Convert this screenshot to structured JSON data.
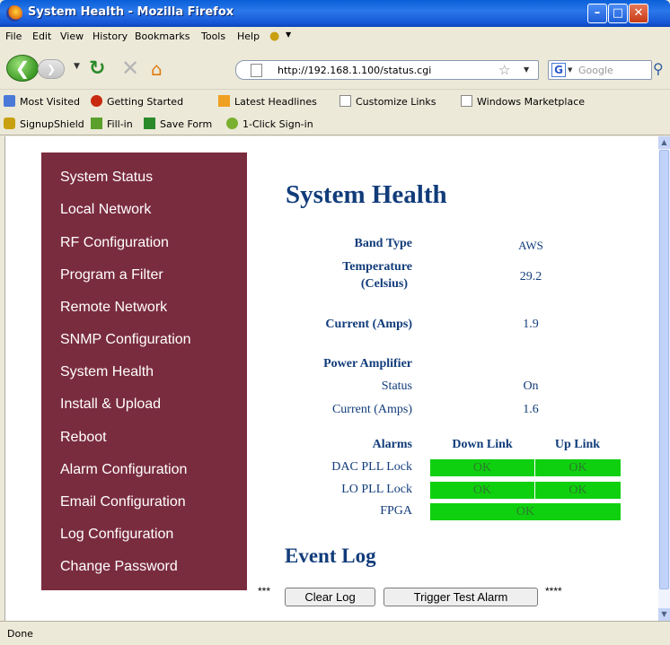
{
  "window": {
    "title": "System Health - Mozilla Firefox"
  },
  "menu": [
    "File",
    "Edit",
    "View",
    "History",
    "Bookmarks",
    "Tools",
    "Help"
  ],
  "nav": {
    "url": "http://192.168.1.100/status.cgi",
    "search_placeholder": "Google"
  },
  "bookmarks": [
    "Most Visited",
    "Getting Started",
    "Latest Headlines",
    "Customize Links",
    "Windows Marketplace"
  ],
  "signup_bar": [
    "SignupShield",
    "Fill-in",
    "Save Form",
    "1-Click Sign-in"
  ],
  "sidebar": [
    "System Status",
    "Local Network",
    "RF Configuration",
    "Program a Filter",
    "Remote Network",
    "SNMP Configuration",
    "System Health",
    "Install & Upload",
    "Reboot",
    "Alarm Configuration",
    "Email Configuration",
    "Log Configuration",
    "Change Password"
  ],
  "health": {
    "title": "System Health",
    "band_type_label": "Band Type",
    "band_type_value": "AWS",
    "temperature_label_1": "Temperature",
    "temperature_label_2": "(Celsius)",
    "temperature_value": "29.2",
    "current_label": "Current (Amps)",
    "current_value": "1.9",
    "pa_heading": "Power Amplifier",
    "pa_status_label": "Status",
    "pa_status_value": "On",
    "pa_current_label": "Current (Amps)",
    "pa_current_value": "1.6"
  },
  "alarms": {
    "heading": "Alarms",
    "down_link": "Down Link",
    "up_link": "Up Link",
    "rows": [
      {
        "name": "DAC PLL Lock",
        "down": "OK",
        "up": "OK"
      },
      {
        "name": "LO PLL Lock",
        "down": "OK",
        "up": "OK"
      },
      {
        "name": "FPGA",
        "both": "OK"
      }
    ]
  },
  "event_log": {
    "title": "Event Log",
    "clear_button": "Clear Log",
    "trigger_button": "Trigger Test Alarm",
    "left_marker": "***",
    "right_marker": "****"
  },
  "status": "Done",
  "colors": {
    "sidebar": "#7a2c3f",
    "heading": "#113c7a",
    "ok_green": "#0fd00f"
  }
}
